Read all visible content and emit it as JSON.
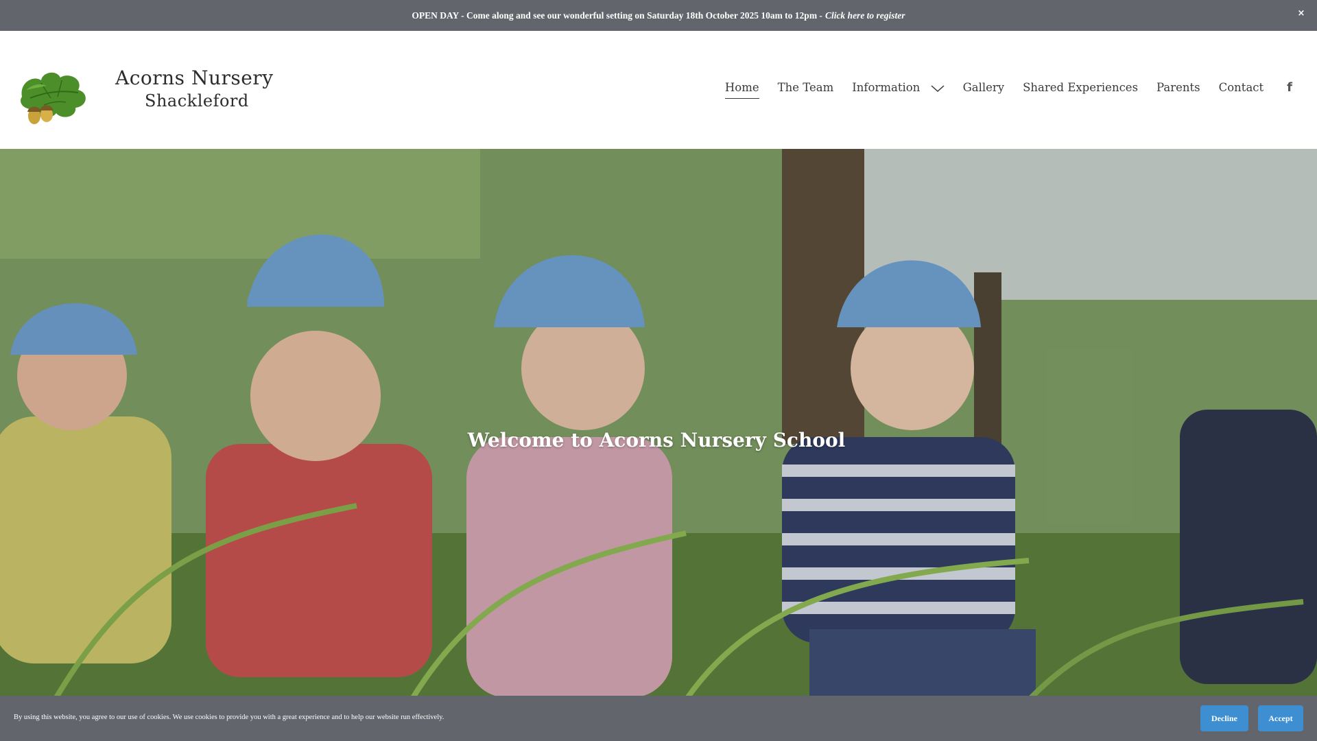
{
  "announcement": {
    "text": "OPEN DAY - Come along and see our wonderful setting on Saturday 18th October 2025  10am to 12pm -",
    "cta": "Click here to register",
    "close_label": "×"
  },
  "logo": {
    "line1": "Acorns Nursery",
    "line2": "Shackleford",
    "icon": "oak-leaf-acorn-icon"
  },
  "nav": {
    "items": [
      {
        "label": "Home",
        "active": true
      },
      {
        "label": "The Team"
      },
      {
        "label": "Information",
        "has_dropdown": true
      },
      {
        "label": "Gallery"
      },
      {
        "label": "Shared Experiences"
      },
      {
        "label": "Parents"
      },
      {
        "label": "Contact"
      }
    ],
    "social_icon": "facebook-icon",
    "social_glyph": "f"
  },
  "hero": {
    "title": "Welcome to Acorns Nursery School"
  },
  "cookie": {
    "text": "By using this website, you agree to our use of cookies. We use cookies to provide you with a great experience and to help our website run effectively.",
    "decline_label": "Decline",
    "accept_label": "Accept",
    "button_color": "#3d8fd1"
  },
  "colors": {
    "bar_background": "#62656b",
    "nav_text": "#3a3a3a"
  }
}
